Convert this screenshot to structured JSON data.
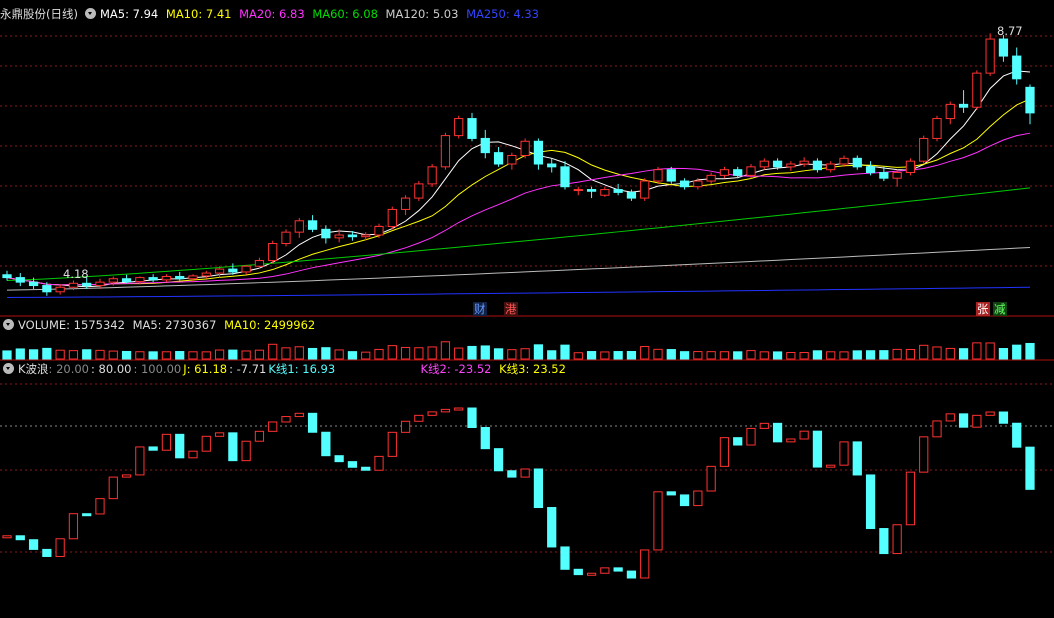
{
  "colors": {
    "bg": "#000000",
    "up": "#ff3232",
    "down": "#54ffff",
    "grid": "#8a1a1a",
    "ma5": "#ffffff",
    "ma10": "#ffff00",
    "ma20": "#ff33ff",
    "ma60": "#00cc00",
    "ma120": "#bbbbbb",
    "ma250": "#2233ff"
  },
  "icons": [
    "collapse-icon"
  ],
  "main": {
    "stock_name": "永鼎股份",
    "period": "(日线)",
    "ma": [
      {
        "label": "MA5: 7.94",
        "key": "ma5"
      },
      {
        "label": "MA10: 7.41",
        "key": "ma10"
      },
      {
        "label": "MA20: 6.83",
        "key": "ma20"
      },
      {
        "label": "MA60: 6.08",
        "key": "ma60"
      },
      {
        "label": "MA120: 5.03",
        "key": "ma120"
      },
      {
        "label": "MA250: 4.33",
        "key": "ma250"
      }
    ],
    "high_label": "8.77",
    "low_label": "4.18",
    "markers": [
      {
        "text": "财",
        "color": "#6699ff",
        "bg": "#112244"
      },
      {
        "text": "港",
        "color": "#ff5555",
        "bg": "#441111"
      },
      {
        "text": "张",
        "color": "#ffffff",
        "bg": "#aa2222"
      },
      {
        "text": "减",
        "color": "#66ff66",
        "bg": "#114411"
      }
    ]
  },
  "volume": {
    "title": "VOLUME: 1575342",
    "ma5": "MA5: 2730367",
    "ma10": "MA10: 2499962"
  },
  "indicator": {
    "name": "K波浪",
    "p1": ": 20.00",
    "p2": ": 80.00",
    "p3": ": 100.00",
    "j": "J: 61.18",
    "j2": ": -7.71",
    "k1": "K线1: 16.93",
    "k2": "K线2: -23.52",
    "k3": "K线3: 23.52"
  },
  "chart_data": {
    "type": "candlestick",
    "ylim": [
      4.0,
      9.0
    ],
    "candles": [
      [
        4.55,
        4.62,
        4.45,
        4.5
      ],
      [
        4.5,
        4.58,
        4.35,
        4.42
      ],
      [
        4.42,
        4.5,
        4.3,
        4.36
      ],
      [
        4.36,
        4.42,
        4.18,
        4.25
      ],
      [
        4.25,
        4.38,
        4.2,
        4.33
      ],
      [
        4.33,
        4.45,
        4.28,
        4.4
      ],
      [
        4.4,
        4.5,
        4.3,
        4.36
      ],
      [
        4.36,
        4.48,
        4.3,
        4.42
      ],
      [
        4.42,
        4.52,
        4.36,
        4.48
      ],
      [
        4.48,
        4.55,
        4.4,
        4.43
      ],
      [
        4.43,
        4.52,
        4.38,
        4.5
      ],
      [
        4.5,
        4.56,
        4.42,
        4.46
      ],
      [
        4.46,
        4.56,
        4.42,
        4.52
      ],
      [
        4.52,
        4.6,
        4.45,
        4.48
      ],
      [
        4.48,
        4.56,
        4.42,
        4.53
      ],
      [
        4.53,
        4.62,
        4.48,
        4.58
      ],
      [
        4.58,
        4.7,
        4.5,
        4.65
      ],
      [
        4.65,
        4.75,
        4.55,
        4.6
      ],
      [
        4.6,
        4.72,
        4.55,
        4.7
      ],
      [
        4.7,
        4.85,
        4.65,
        4.8
      ],
      [
        4.8,
        5.15,
        4.75,
        5.1
      ],
      [
        5.1,
        5.35,
        5.05,
        5.3
      ],
      [
        5.3,
        5.55,
        5.2,
        5.5
      ],
      [
        5.5,
        5.6,
        5.3,
        5.35
      ],
      [
        5.35,
        5.42,
        5.1,
        5.2
      ],
      [
        5.2,
        5.35,
        5.12,
        5.25
      ],
      [
        5.25,
        5.32,
        5.15,
        5.22
      ],
      [
        5.22,
        5.3,
        5.15,
        5.25
      ],
      [
        5.25,
        5.45,
        5.2,
        5.4
      ],
      [
        5.4,
        5.75,
        5.35,
        5.7
      ],
      [
        5.7,
        5.95,
        5.6,
        5.9
      ],
      [
        5.9,
        6.2,
        5.85,
        6.15
      ],
      [
        6.15,
        6.5,
        6.1,
        6.45
      ],
      [
        6.45,
        7.05,
        6.4,
        7.0
      ],
      [
        7.0,
        7.35,
        6.95,
        7.3
      ],
      [
        7.3,
        7.4,
        6.9,
        6.95
      ],
      [
        6.95,
        7.1,
        6.6,
        6.7
      ],
      [
        6.7,
        6.8,
        6.45,
        6.5
      ],
      [
        6.5,
        6.7,
        6.4,
        6.65
      ],
      [
        6.65,
        6.95,
        6.6,
        6.9
      ],
      [
        6.9,
        6.95,
        6.4,
        6.5
      ],
      [
        6.5,
        6.6,
        6.35,
        6.45
      ],
      [
        6.45,
        6.55,
        6.05,
        6.1
      ],
      [
        6.05,
        6.1,
        5.95,
        6.05
      ],
      [
        6.05,
        6.1,
        5.9,
        6.02
      ],
      [
        5.95,
        6.1,
        5.92,
        6.05
      ],
      [
        6.05,
        6.15,
        5.95,
        6.0
      ],
      [
        6.0,
        6.05,
        5.85,
        5.9
      ],
      [
        5.9,
        6.25,
        5.85,
        6.2
      ],
      [
        6.2,
        6.45,
        6.15,
        6.4
      ],
      [
        6.4,
        6.45,
        6.15,
        6.2
      ],
      [
        6.2,
        6.25,
        6.05,
        6.1
      ],
      [
        6.1,
        6.25,
        6.05,
        6.2
      ],
      [
        6.2,
        6.35,
        6.15,
        6.3
      ],
      [
        6.3,
        6.45,
        6.25,
        6.4
      ],
      [
        6.4,
        6.45,
        6.25,
        6.3
      ],
      [
        6.3,
        6.5,
        6.25,
        6.45
      ],
      [
        6.45,
        6.6,
        6.4,
        6.55
      ],
      [
        6.55,
        6.6,
        6.4,
        6.45
      ],
      [
        6.45,
        6.55,
        6.38,
        6.5
      ],
      [
        6.5,
        6.62,
        6.45,
        6.55
      ],
      [
        6.55,
        6.6,
        6.35,
        6.4
      ],
      [
        6.4,
        6.55,
        6.35,
        6.5
      ],
      [
        6.5,
        6.65,
        6.45,
        6.6
      ],
      [
        6.6,
        6.65,
        6.4,
        6.45
      ],
      [
        6.45,
        6.55,
        6.3,
        6.35
      ],
      [
        6.35,
        6.45,
        6.2,
        6.25
      ],
      [
        6.25,
        6.4,
        6.1,
        6.35
      ],
      [
        6.35,
        6.6,
        6.3,
        6.55
      ],
      [
        6.55,
        7.0,
        6.5,
        6.95
      ],
      [
        6.95,
        7.35,
        6.9,
        7.3
      ],
      [
        7.3,
        7.6,
        7.2,
        7.55
      ],
      [
        7.55,
        7.8,
        7.4,
        7.5
      ],
      [
        7.5,
        8.15,
        7.45,
        8.1
      ],
      [
        8.1,
        8.8,
        8.05,
        8.7
      ],
      [
        8.7,
        8.77,
        8.3,
        8.4
      ],
      [
        8.4,
        8.55,
        7.9,
        8.0
      ],
      [
        7.85,
        7.9,
        7.2,
        7.4
      ]
    ],
    "volume_ylim": [
      0,
      6000000
    ],
    "indicator_ylim": [
      -10,
      110
    ],
    "indicator_levels": [
      0,
      20,
      80,
      100
    ]
  }
}
